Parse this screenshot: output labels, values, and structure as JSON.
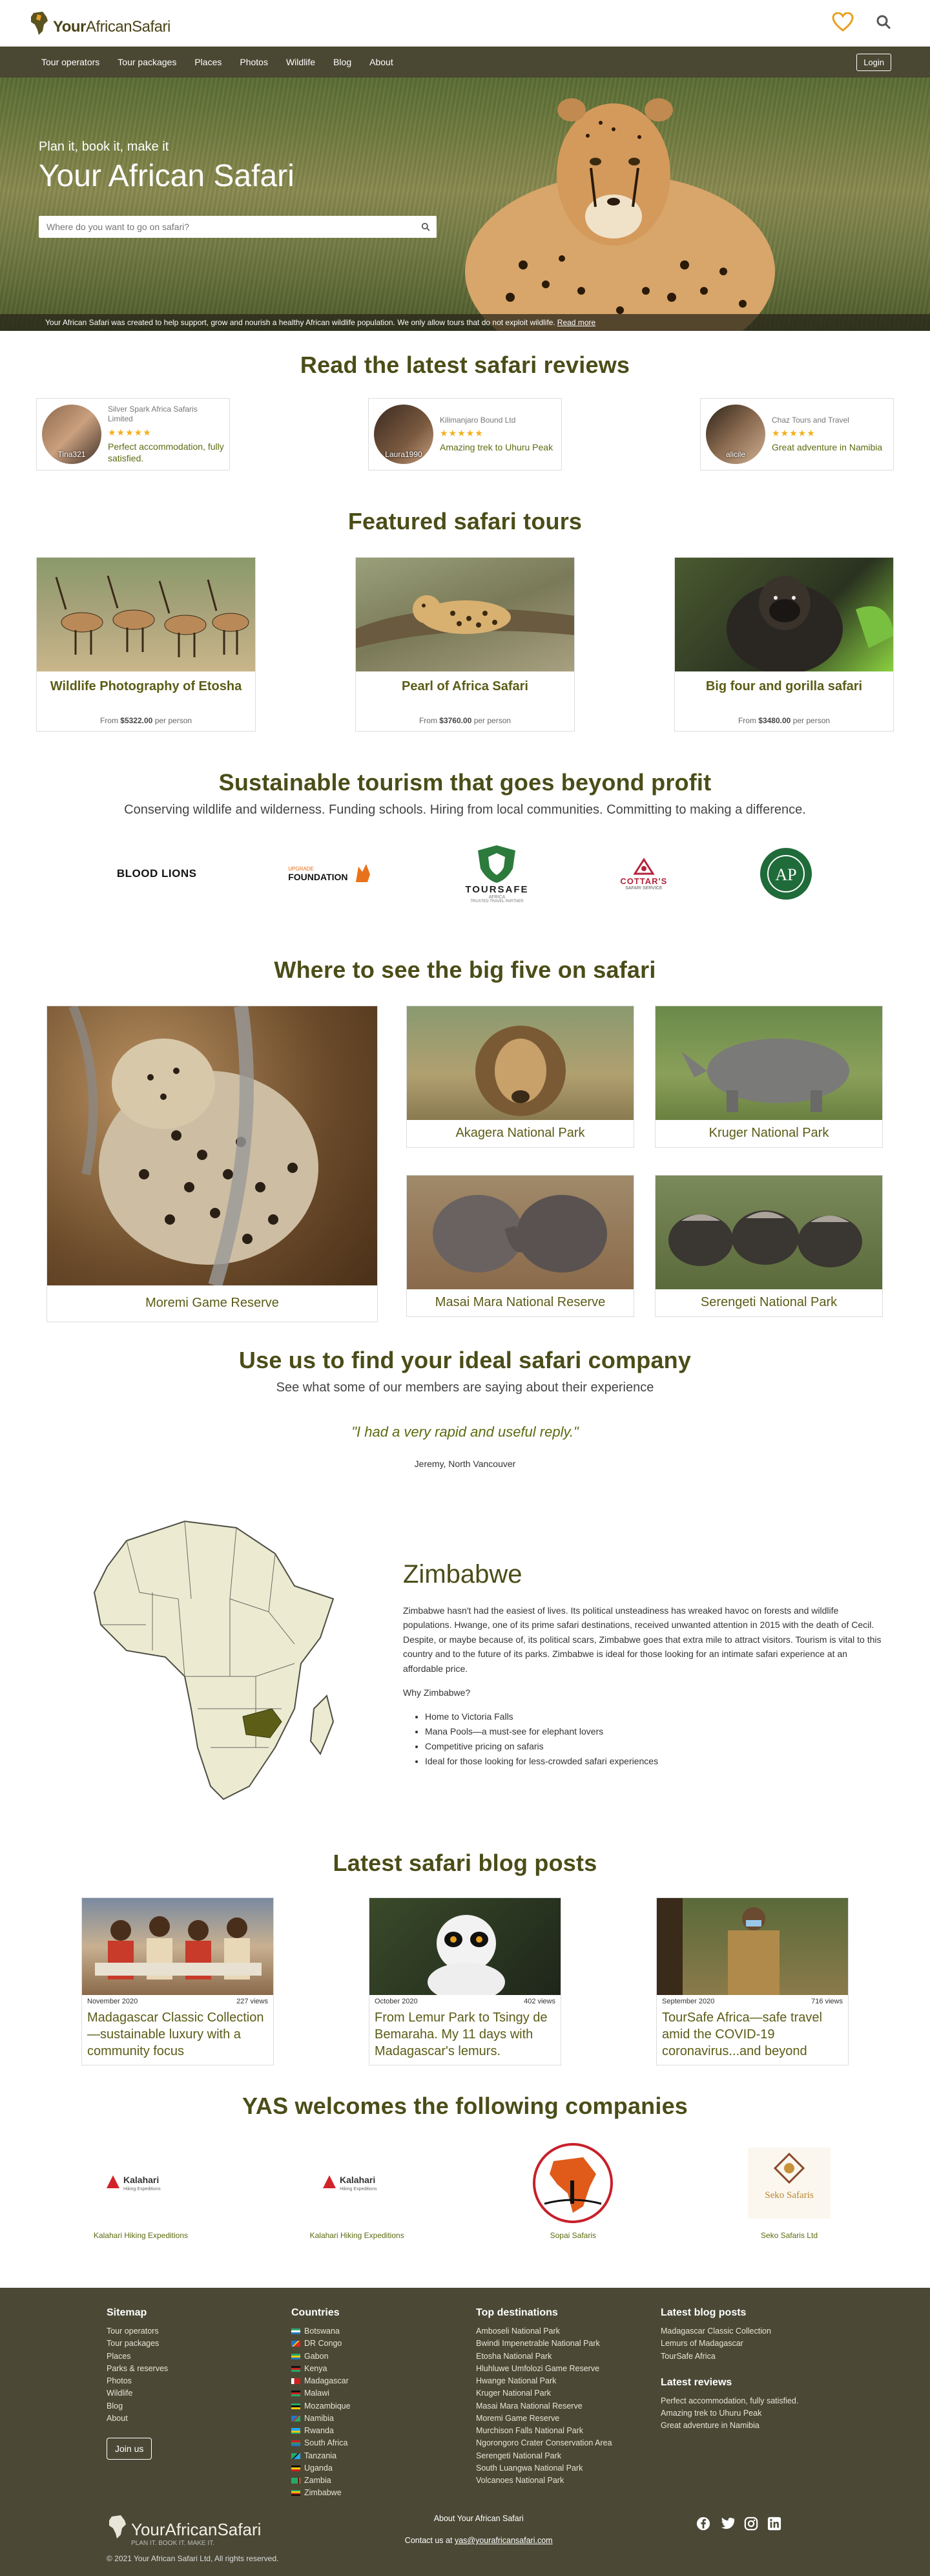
{
  "brand": {
    "name_your": "Your",
    "name_rest": "AfricanSafari"
  },
  "header": {
    "wishlist_icon": "heart-icon",
    "search_icon": "search-icon"
  },
  "nav": {
    "items": [
      "Tour operators",
      "Tour packages",
      "Places",
      "Photos",
      "Wildlife",
      "Blog",
      "About"
    ],
    "login": "Login"
  },
  "hero": {
    "subtitle": "Plan it, book it, make it",
    "title": "Your African Safari",
    "search_placeholder": "Where do you want to go on safari?",
    "banner": "Your African Safari was created to help support, grow and nourish a healthy African wildlife population. We only allow tours that do not exploit wildlife.",
    "banner_link": "Read more"
  },
  "reviews": {
    "title": "Read the latest safari reviews",
    "items": [
      {
        "user": "Tina321",
        "company": "Silver Spark Africa Safaris Limited",
        "stars": 5,
        "text": "Perfect accommodation, fully satisfied."
      },
      {
        "user": "Laura1990",
        "company": "Kilimanjaro Bound Ltd",
        "stars": 5,
        "text": "Amazing trek to Uhuru Peak"
      },
      {
        "user": "alicile",
        "company": "Chaz Tours and Travel",
        "stars": 5,
        "text": "Great adventure in Namibia"
      }
    ]
  },
  "tours": {
    "title": "Featured safari tours",
    "items": [
      {
        "name": "Wildlife Photography of Etosha",
        "price_prefix": "From",
        "price": "$5322.00",
        "price_suffix": "per person"
      },
      {
        "name": "Pearl of Africa Safari",
        "price_prefix": "From",
        "price": "$3760.00",
        "price_suffix": "per person"
      },
      {
        "name": "Big four and gorilla safari",
        "price_prefix": "From",
        "price": "$3480.00",
        "price_suffix": "per person"
      }
    ]
  },
  "sustainable": {
    "title": "Sustainable tourism that goes beyond profit",
    "subtitle": "Conserving wildlife and wilderness. Funding schools. Hiring from local communities. Committing to making a difference.",
    "partners": [
      "BLOOD LIONS",
      "FOUNDATION",
      "TOURSAFE",
      "COTTAR'S",
      "AP"
    ],
    "partner_small": {
      "found_top": "UPGRADE",
      "toursafe_sub": "AFRICA",
      "toursafe_tag": "TRUSTED TRAVEL PARTNER",
      "cottars_sub": "SAFARI SERVICE"
    }
  },
  "bigfive": {
    "title": "Where to see the big five on safari",
    "parks": [
      "Moremi Game Reserve",
      "Akagera National Park",
      "Kruger National Park",
      "Masai Mara National Reserve",
      "Serengeti National Park"
    ]
  },
  "testimonials": {
    "title": "Use us to find your ideal safari company",
    "subtitle": "See what some of our members are saying about their experience",
    "quote": "\"I had a very rapid and useful reply.\"",
    "author": "Jeremy, North Vancouver"
  },
  "zimbabwe": {
    "title": "Zimbabwe",
    "paragraph": "Zimbabwe hasn't had the easiest of lives. Its political unsteadiness has wreaked havoc on forests and wildlife populations. Hwange, one of its prime safari destinations, received unwanted attention in 2015 with the death of Cecil. Despite, or maybe because of, its political scars, Zimbabwe goes that extra mile to attract visitors. Tourism is vital to this country and to the future of its parks. Zimbabwe is ideal for those looking for an intimate safari experience at an affordable price.",
    "why": "Why Zimbabwe?",
    "reasons": [
      "Home to Victoria Falls",
      "Mana Pools—a must-see for elephant lovers",
      "Competitive pricing on safaris",
      "Ideal for those looking for less-crowded safari experiences"
    ]
  },
  "blog": {
    "title": "Latest safari blog posts",
    "posts": [
      {
        "date": "November 2020",
        "views": "227 views",
        "title": "Madagascar Classic Collection—sustainable luxury with a community focus"
      },
      {
        "date": "October 2020",
        "views": "402 views",
        "title": "From Lemur Park to Tsingy de Bemaraha. My 11 days with Madagascar's lemurs."
      },
      {
        "date": "September 2020",
        "views": "716 views",
        "title": "TourSafe Africa—safe travel amid the COVID-19 coronavirus...and beyond"
      }
    ]
  },
  "companies": {
    "title": "YAS welcomes the following companies",
    "items": [
      {
        "name": "Kalahari Hiking Expeditions",
        "logo_text": "Kalahari",
        "logo_sub": "Hiking Expeditions"
      },
      {
        "name": "Kalahari Hiking Expeditions",
        "logo_text": "Kalahari",
        "logo_sub": "Hiking Expeditions"
      },
      {
        "name": "Sopai Safaris",
        "logo_text": "",
        "logo_sub": ""
      },
      {
        "name": "Seko Safaris Ltd",
        "logo_text": "Seko Safaris",
        "logo_sub": ""
      }
    ]
  },
  "footer": {
    "sitemap_title": "Sitemap",
    "sitemap": [
      "Tour operators",
      "Tour packages",
      "Places",
      "Parks & reserves",
      "Photos",
      "Wildlife",
      "Blog",
      "About"
    ],
    "join": "Join us",
    "countries_title": "Countries",
    "countries": [
      "Botswana",
      "DR Congo",
      "Gabon",
      "Kenya",
      "Madagascar",
      "Malawi",
      "Mozambique",
      "Namibia",
      "Rwanda",
      "South Africa",
      "Tanzania",
      "Uganda",
      "Zambia",
      "Zimbabwe"
    ],
    "destinations_title": "Top destinations",
    "destinations": [
      "Amboseli National Park",
      "Bwindi Impenetrable National Park",
      "Etosha National Park",
      "Hluhluwe Umfolozi Game Reserve",
      "Hwange National Park",
      "Kruger National Park",
      "Masai Mara National Reserve",
      "Moremi Game Reserve",
      "Murchison Falls National Park",
      "Ngorongoro Crater Conservation Area",
      "Serengeti National Park",
      "South Luangwa National Park",
      "Volcanoes National Park"
    ],
    "blog_title": "Latest blog posts",
    "blog_posts": [
      "Madagascar Classic Collection",
      "Lemurs of Madagascar",
      "TourSafe Africa"
    ],
    "reviews_title": "Latest reviews",
    "reviews": [
      "Perfect accommodation, fully satisfied.",
      "Amazing trek to Uhuru Peak",
      "Great adventure in Namibia"
    ],
    "logo_tagline": "PLAN IT. BOOK IT. MAKE IT.",
    "about": "About Your African Safari",
    "contact_prefix": "Contact us at",
    "email": "yas@yourafricansafari.com",
    "copyright": "© 2021 Your African Safari Ltd, All rights reserved.",
    "social": [
      "facebook-icon",
      "twitter-icon",
      "instagram-icon",
      "linkedin-icon"
    ]
  },
  "colors": {
    "olive": "#4b4d18",
    "nav": "#4a4733",
    "accent_orange": "#e8a020",
    "stars": "#f2b01e"
  }
}
